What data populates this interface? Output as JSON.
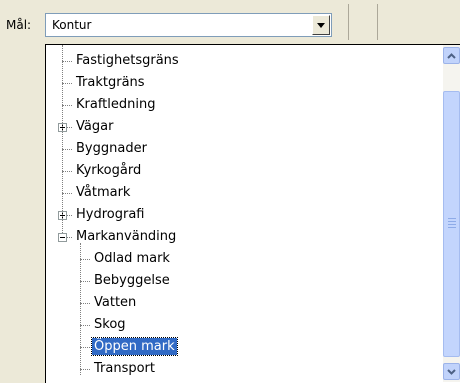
{
  "toolbar": {
    "goal_label": "Mål:",
    "combo": {
      "selected_value": "Kontur"
    }
  },
  "tree": {
    "items": [
      {
        "label": "Fastighetsgräns",
        "expander": "none"
      },
      {
        "label": "Traktgräns",
        "expander": "none"
      },
      {
        "label": "Kraftledning",
        "expander": "none"
      },
      {
        "label": "Vägar",
        "expander": "plus"
      },
      {
        "label": "Byggnader",
        "expander": "none"
      },
      {
        "label": "Kyrkogård",
        "expander": "none"
      },
      {
        "label": "Våtmark",
        "expander": "none"
      },
      {
        "label": "Hydrografi",
        "expander": "plus"
      },
      {
        "label": "Markanvänding",
        "expander": "minus"
      },
      {
        "label": "Odlad mark",
        "expander": "none"
      },
      {
        "label": "Bebyggelse",
        "expander": "none"
      },
      {
        "label": "Vatten",
        "expander": "none"
      },
      {
        "label": "Skog",
        "expander": "none"
      },
      {
        "label": "Öppen mark",
        "expander": "none",
        "selected": true
      },
      {
        "label": "Transport",
        "expander": "none"
      }
    ]
  },
  "scrollbar": {
    "position": "top"
  },
  "colors": {
    "selection": "#316ac5",
    "combo_border": "#7f9db9",
    "scrollbar_thumb": "#c3d5fd"
  },
  "icons": {
    "combo_arrow": "triangle-down-icon",
    "scroll_up": "chevron-up-icon",
    "scroll_down": "chevron-down-icon"
  }
}
